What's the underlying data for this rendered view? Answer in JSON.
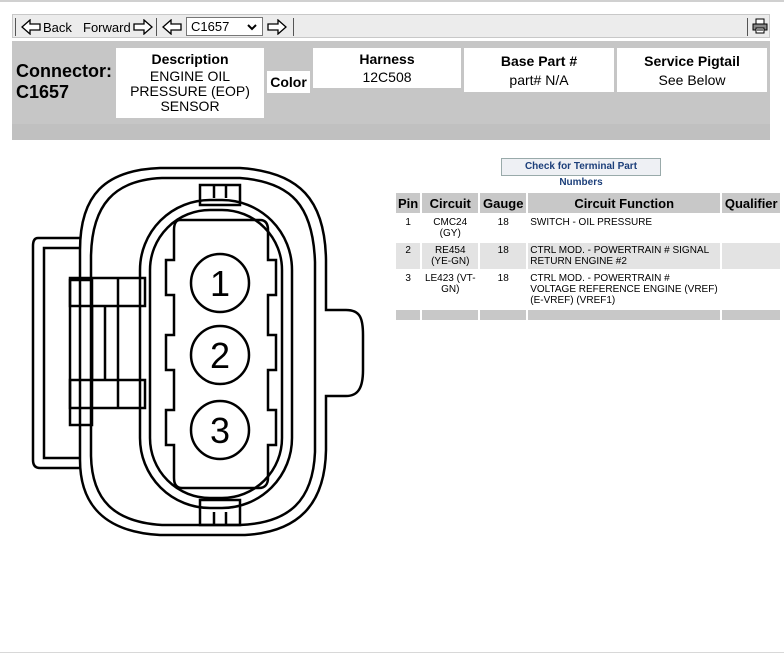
{
  "toolbar": {
    "back_label": "Back",
    "forward_label": "Forward",
    "connector_select": "C1657"
  },
  "header": {
    "connector_label": "Connector:",
    "connector_id": "C1657",
    "description_label": "Description",
    "description_value": [
      "ENGINE OIL",
      "PRESSURE (EOP)",
      "SENSOR"
    ],
    "color_label": "Color",
    "harness_label": "Harness",
    "harness_value": "12C508",
    "base_part_label": "Base Part #",
    "base_part_value": "part# N/A",
    "pigtail_label": "Service Pigtail",
    "pigtail_value": "See Below"
  },
  "terminal_button": "Check for Terminal Part Numbers",
  "connector_pins": [
    "1",
    "2",
    "3"
  ],
  "pin_table": {
    "headers": [
      "Pin",
      "Circuit",
      "Gauge",
      "Circuit Function",
      "Qualifier"
    ],
    "rows": [
      {
        "pin": "1",
        "circuit": [
          "CMC24",
          "(GY)"
        ],
        "gauge": "18",
        "function": [
          "SWITCH - OIL PRESSURE"
        ],
        "qualifier": ""
      },
      {
        "pin": "2",
        "circuit": [
          "RE454",
          "(YE-GN)"
        ],
        "gauge": "18",
        "function": [
          "CTRL MOD. - POWERTRAIN # SIGNAL",
          "RETURN ENGINE #2"
        ],
        "qualifier": ""
      },
      {
        "pin": "3",
        "circuit": [
          "LE423 (VT-",
          "GN)"
        ],
        "gauge": "18",
        "function": [
          "CTRL MOD. - POWERTRAIN #",
          "VOLTAGE REFERENCE ENGINE (VREF)",
          "(E-VREF) (VREF1)"
        ],
        "qualifier": ""
      }
    ]
  }
}
